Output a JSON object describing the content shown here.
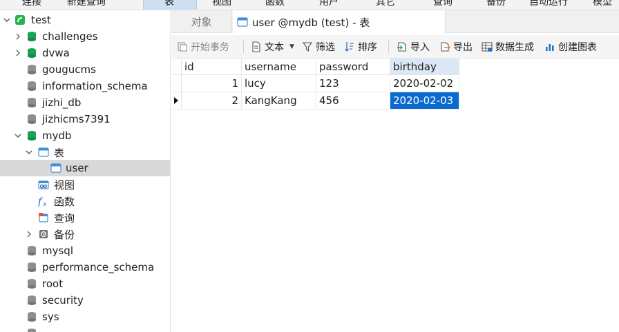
{
  "top_toolbar": {
    "items": [
      "连接",
      "新建查询",
      "表",
      "视图",
      "函数",
      "用户",
      "其它",
      "查询",
      "备份",
      "自动运行",
      "模型"
    ]
  },
  "sidebar": {
    "items": [
      {
        "label": "test",
        "icon": "connection-icon"
      },
      {
        "label": "challenges",
        "icon": "database-open-icon"
      },
      {
        "label": "dvwa",
        "icon": "database-open-icon"
      },
      {
        "label": "gougucms",
        "icon": "database-icon"
      },
      {
        "label": "information_schema",
        "icon": "database-icon"
      },
      {
        "label": "jizhi_db",
        "icon": "database-icon"
      },
      {
        "label": "jizhicms7391",
        "icon": "database-icon"
      },
      {
        "label": "mydb",
        "icon": "database-open-icon"
      },
      {
        "label": "表",
        "icon": "tables-icon"
      },
      {
        "label": "user",
        "icon": "table-icon"
      },
      {
        "label": "视图",
        "icon": "view-icon"
      },
      {
        "label": "函数",
        "icon": "function-icon"
      },
      {
        "label": "查询",
        "icon": "query-icon"
      },
      {
        "label": "备份",
        "icon": "backup-icon"
      },
      {
        "label": "mysql",
        "icon": "database-icon"
      },
      {
        "label": "performance_schema",
        "icon": "database-icon"
      },
      {
        "label": "root",
        "icon": "database-icon"
      },
      {
        "label": "security",
        "icon": "database-icon"
      },
      {
        "label": "sys",
        "icon": "database-icon"
      }
    ]
  },
  "tabs": {
    "objects_label": "对象",
    "active_label": "user @mydb (test) - 表"
  },
  "toolbar": {
    "begin_transaction": "开始事务",
    "text": "文本",
    "filter": "筛选",
    "sort": "排序",
    "import": "导入",
    "export": "导出",
    "data_generation": "数据生成",
    "create_chart": "创建图表"
  },
  "grid": {
    "columns": [
      "id",
      "username",
      "password",
      "birthday"
    ],
    "rows": [
      [
        "1",
        "lucy",
        "123",
        "2020-02-02"
      ],
      [
        "2",
        "KangKang",
        "456",
        "2020-02-03"
      ]
    ]
  },
  "colors": {
    "selection_blue": "#0a6ad0",
    "db_green": "#1aa35a",
    "connection_green": "#2bb24c"
  }
}
